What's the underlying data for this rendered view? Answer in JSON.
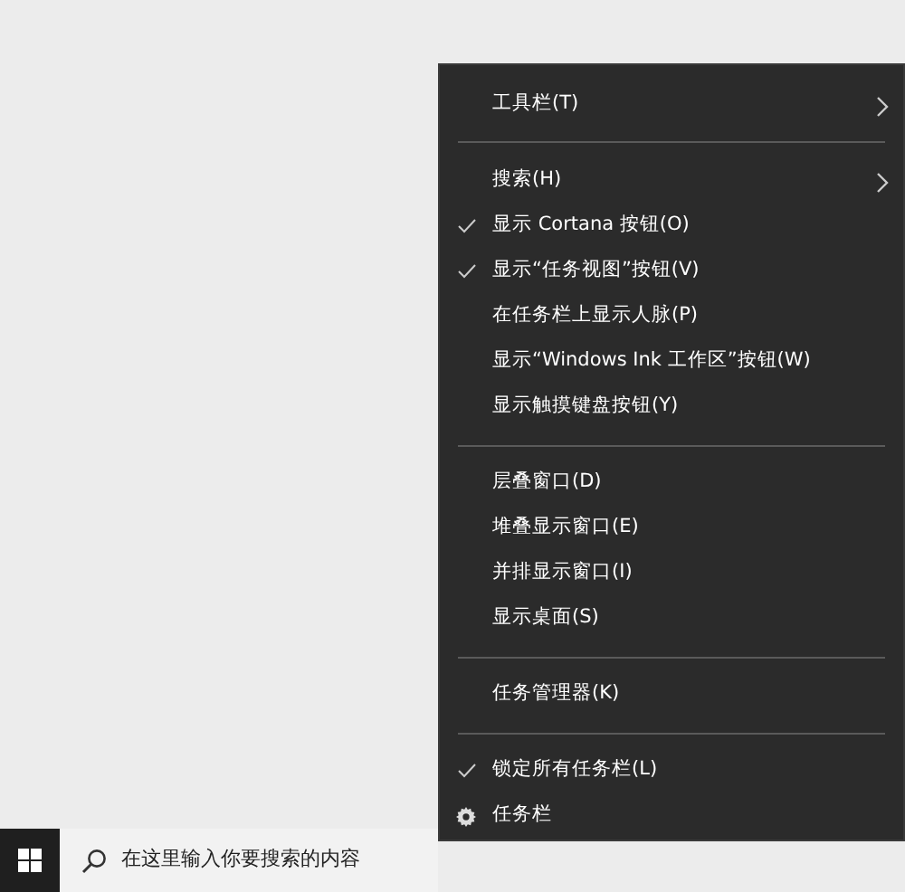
{
  "context_menu": {
    "items": [
      {
        "kind": "item",
        "label": "工具栏(T)",
        "checked": false,
        "submenu": true
      },
      {
        "kind": "separator"
      },
      {
        "kind": "item",
        "label": "搜索(H)",
        "checked": false,
        "submenu": true
      },
      {
        "kind": "item",
        "label": "显示 Cortana 按钮(O)",
        "checked": true,
        "submenu": false
      },
      {
        "kind": "item",
        "label": "显示“任务视图”按钮(V)",
        "checked": true,
        "submenu": false
      },
      {
        "kind": "item",
        "label": "在任务栏上显示人脉(P)",
        "checked": false,
        "submenu": false
      },
      {
        "kind": "item",
        "label": "显示“Windows Ink 工作区”按钮(W)",
        "checked": false,
        "submenu": false
      },
      {
        "kind": "item",
        "label": "显示触摸键盘按钮(Y)",
        "checked": false,
        "submenu": false
      },
      {
        "kind": "separator"
      },
      {
        "kind": "item",
        "label": "层叠窗口(D)",
        "checked": false,
        "submenu": false
      },
      {
        "kind": "item",
        "label": "堆叠显示窗口(E)",
        "checked": false,
        "submenu": false
      },
      {
        "kind": "item",
        "label": "并排显示窗口(I)",
        "checked": false,
        "submenu": false
      },
      {
        "kind": "item",
        "label": "显示桌面(S)",
        "checked": false,
        "submenu": false
      },
      {
        "kind": "separator"
      },
      {
        "kind": "item",
        "label": "任务管理器(K)",
        "checked": false,
        "submenu": false
      },
      {
        "kind": "separator"
      },
      {
        "kind": "item",
        "label": "锁定所有任务栏(L)",
        "checked": true,
        "submenu": false
      },
      {
        "kind": "settings",
        "label": "任务栏",
        "checked": false,
        "submenu": false
      }
    ]
  },
  "taskbar": {
    "search": {
      "placeholder": "在这里输入你要搜索的内容"
    }
  }
}
